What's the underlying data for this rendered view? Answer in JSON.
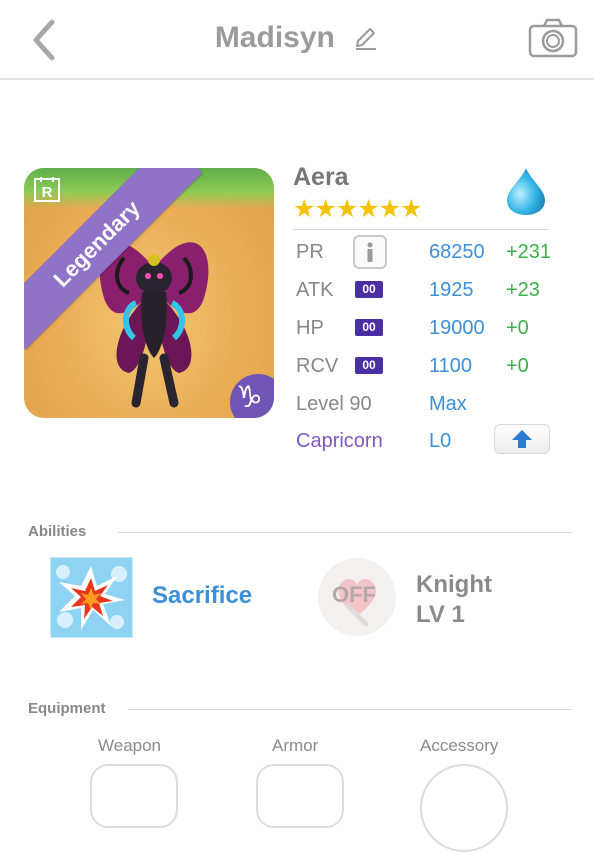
{
  "header": {
    "title": "Madisyn"
  },
  "monster": {
    "rarity": "Legendary",
    "name": "Aera",
    "stars": "★★★★★★",
    "element": "water",
    "zodiac_symbol": "♑"
  },
  "stats": [
    {
      "label": "PR",
      "value": "68250",
      "bonus": "+231",
      "badge": ""
    },
    {
      "label": "ATK",
      "value": "1925",
      "bonus": "+23",
      "badge": "00"
    },
    {
      "label": "HP",
      "value": "19000",
      "bonus": "+0",
      "badge": "00"
    },
    {
      "label": "RCV",
      "value": "1100",
      "bonus": "+0",
      "badge": "00"
    }
  ],
  "level": {
    "label": "Level 90",
    "value": "Max"
  },
  "sign": {
    "label": "Capricorn",
    "value": "L0"
  },
  "abilities": {
    "section_title": "Abilities",
    "skill_name": "Sacrifice",
    "leader_status": "OFF",
    "leader_name": "Knight",
    "leader_level": "LV 1"
  },
  "equipment": {
    "section_title": "Equipment",
    "slots": [
      "Weapon",
      "Armor",
      "Accessory"
    ]
  },
  "colors": {
    "accent_blue": "#3d8fd6",
    "bonus_green": "#3cb04a",
    "legendary_purple": "#8e73c6",
    "zodiac_purple": "#7e57c2",
    "star_gold": "#f5c400"
  }
}
